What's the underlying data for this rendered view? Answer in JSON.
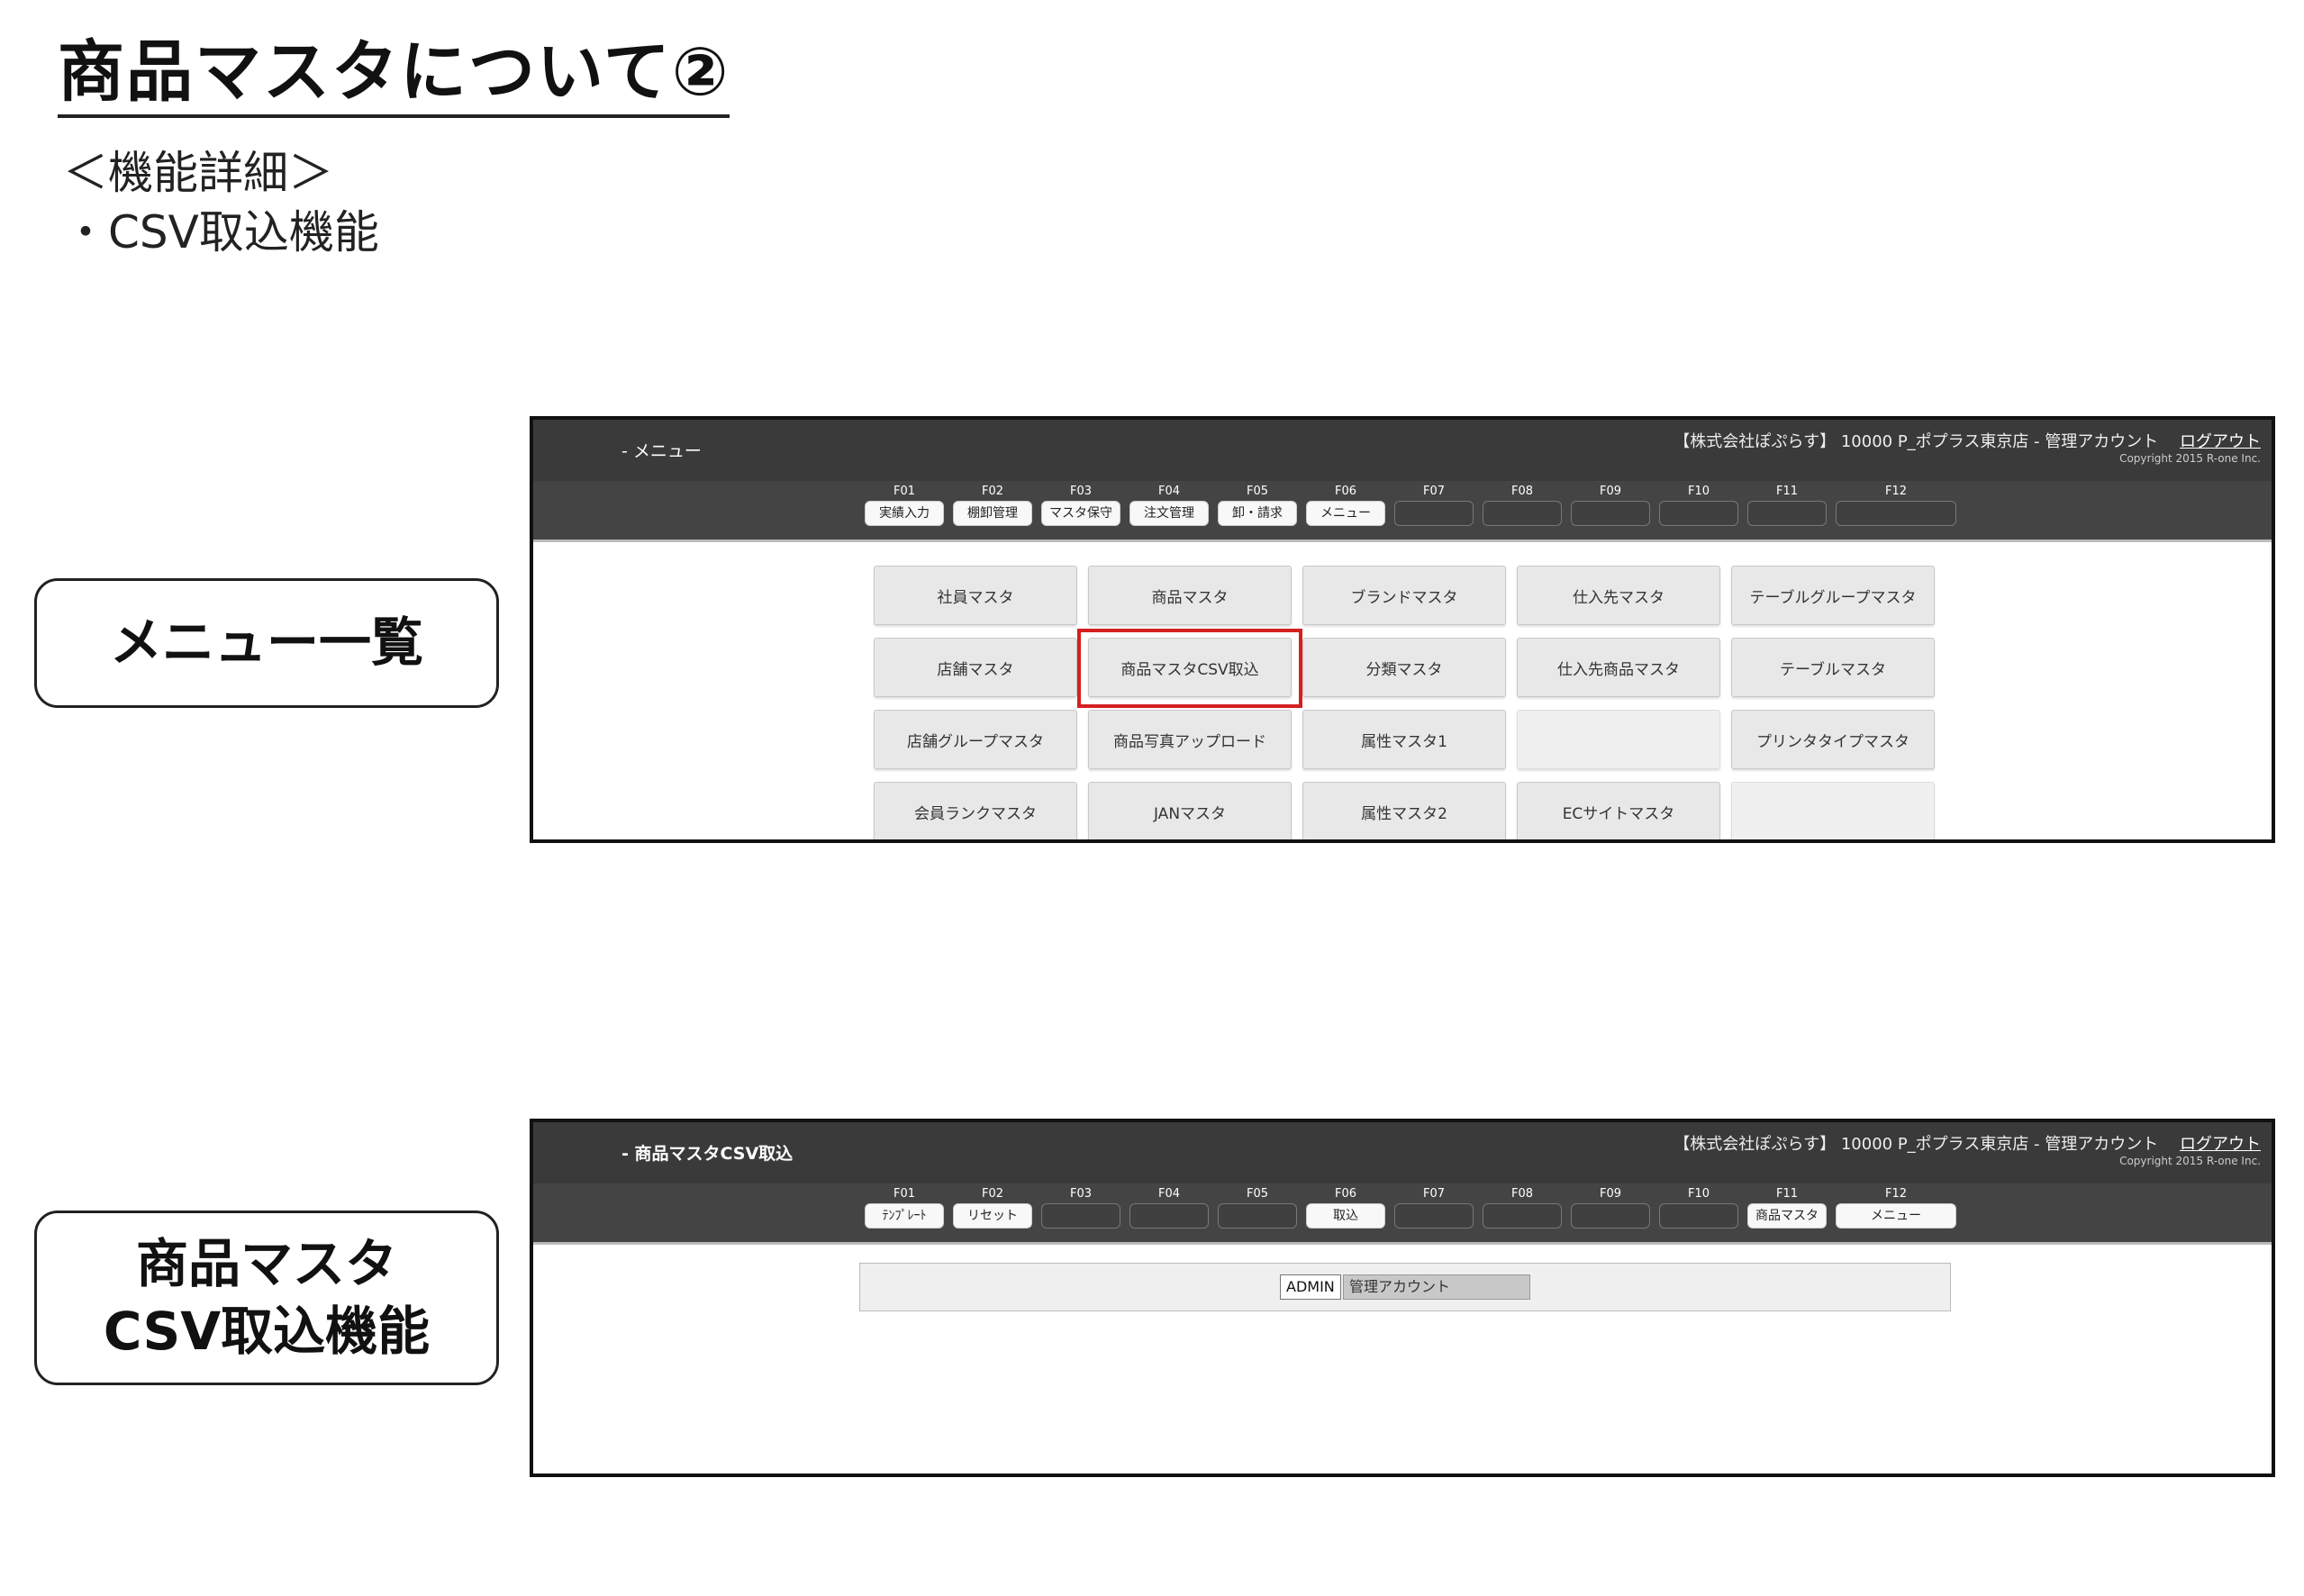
{
  "slide": {
    "title": "商品マスタについて②",
    "subtitle_1": "＜機能詳細＞",
    "subtitle_2": "・CSV取込機能"
  },
  "labels": {
    "menu_list": "メニュー一覧",
    "csv_line1": "商品マスタ",
    "csv_line2": "CSV取込機能"
  },
  "screen1": {
    "title": "- メニュー",
    "user_info": "【株式会社ぽぷらす】 10000 P_ポプラス東京店 - 管理アカウント",
    "logout": "ログアウト",
    "copyright": "Copyright 2015 R-one Inc.",
    "fkeys": [
      {
        "key": "F01",
        "label": "実績入力"
      },
      {
        "key": "F02",
        "label": "棚卸管理"
      },
      {
        "key": "F03",
        "label": "マスタ保守"
      },
      {
        "key": "F04",
        "label": "注文管理"
      },
      {
        "key": "F05",
        "label": "卸・請求"
      },
      {
        "key": "F06",
        "label": "メニュー"
      },
      {
        "key": "F07",
        "label": ""
      },
      {
        "key": "F08",
        "label": ""
      },
      {
        "key": "F09",
        "label": ""
      },
      {
        "key": "F10",
        "label": ""
      },
      {
        "key": "F11",
        "label": ""
      },
      {
        "key": "F12",
        "label": ""
      }
    ],
    "menu_rows": [
      [
        "社員マスタ",
        "商品マスタ",
        "ブランドマスタ",
        "仕入先マスタ",
        "テーブルグループマスタ"
      ],
      [
        "店舗マスタ",
        "商品マスタCSV取込",
        "分類マスタ",
        "仕入先商品マスタ",
        "テーブルマスタ"
      ],
      [
        "店舗グループマスタ",
        "商品写真アップロード",
        "属性マスタ1",
        "",
        "プリンタタイプマスタ"
      ],
      [
        "会員ランクマスタ",
        "JANマスタ",
        "属性マスタ2",
        "ECサイトマスタ",
        ""
      ]
    ],
    "highlight_color": "#d42020"
  },
  "screen2": {
    "title": "- 商品マスタCSV取込",
    "user_info": "【株式会社ぽぷらす】 10000 P_ポプラス東京店 - 管理アカウント",
    "logout": "ログアウト",
    "copyright": "Copyright 2015 R-one Inc.",
    "fkeys": [
      {
        "key": "F01",
        "label": "ﾃﾝﾌﾟﾚｰﾄ"
      },
      {
        "key": "F02",
        "label": "リセット"
      },
      {
        "key": "F03",
        "label": ""
      },
      {
        "key": "F04",
        "label": ""
      },
      {
        "key": "F05",
        "label": ""
      },
      {
        "key": "F06",
        "label": "取込"
      },
      {
        "key": "F07",
        "label": ""
      },
      {
        "key": "F08",
        "label": ""
      },
      {
        "key": "F09",
        "label": ""
      },
      {
        "key": "F10",
        "label": ""
      },
      {
        "key": "F11",
        "label": "商品マスタ"
      },
      {
        "key": "F12",
        "label": "メニュー"
      }
    ],
    "user_code": "ADMIN",
    "user_name": "管理アカウント"
  }
}
